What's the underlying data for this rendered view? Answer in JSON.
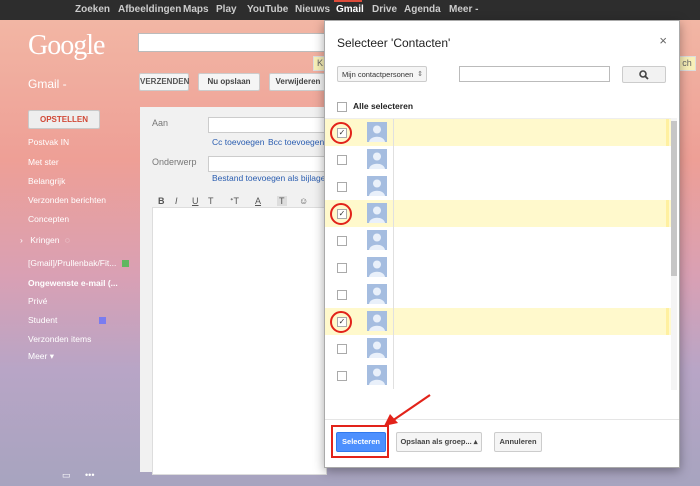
{
  "topnav": [
    "Zoeken",
    "Afbeeldingen",
    "Maps",
    "Play",
    "YouTube",
    "Nieuws",
    "Gmail",
    "Drive",
    "Agenda",
    "Meer -"
  ],
  "active_nav": "Gmail",
  "logo": "Google",
  "gmail_label": "Gmail -",
  "compose_label": "OPSTELLEN",
  "sidebar": [
    {
      "label": "Postvak IN"
    },
    {
      "label": "Met ster"
    },
    {
      "label": "Belangrijk"
    },
    {
      "label": "Verzonden berichten"
    },
    {
      "label": "Concepten"
    },
    {
      "label": "Kringen"
    },
    {
      "label": "[Gmail]/Prullenbak/Fit..."
    },
    {
      "label": "Ongewenste e-mail (..."
    },
    {
      "label": "Privé"
    },
    {
      "label": "Student"
    },
    {
      "label": "Verzonden items"
    },
    {
      "label": "Meer"
    }
  ],
  "toolbar": {
    "send": "VERZENDEN",
    "save": "Nu opslaan",
    "delete": "Verwijderen"
  },
  "compose": {
    "to_label": "Aan",
    "cc": "Cc toevoegen",
    "bcc": "Bcc toevoegen",
    "subject_label": "Onderwerp",
    "attach": "Bestand toevoegen als bijlage"
  },
  "format_glyphs": [
    "B",
    "I",
    "U",
    "T",
    "ᐩT",
    "A",
    "T",
    "☺"
  ],
  "bg_peek": {
    "k": "K",
    "tail": "ch"
  },
  "label_colors": {
    "gmail_trash": "#5fb760",
    "student": "#7a7cf0"
  },
  "dialog": {
    "title": "Selecteer 'Contacten'",
    "close": "×",
    "group_select": "Mijn contactpersonen",
    "select_all": "Alle selecteren",
    "rows": [
      {
        "checked": true
      },
      {
        "checked": false
      },
      {
        "checked": false
      },
      {
        "checked": true
      },
      {
        "checked": false
      },
      {
        "checked": false
      },
      {
        "checked": false
      },
      {
        "checked": true
      },
      {
        "checked": false
      },
      {
        "checked": false
      }
    ],
    "btn_select": "Selecteren",
    "btn_save_group": "Opslaan als groep... ▴",
    "btn_cancel": "Annuleren"
  },
  "accent_color": "#4d90fe",
  "highlight_color": "#e2231a"
}
